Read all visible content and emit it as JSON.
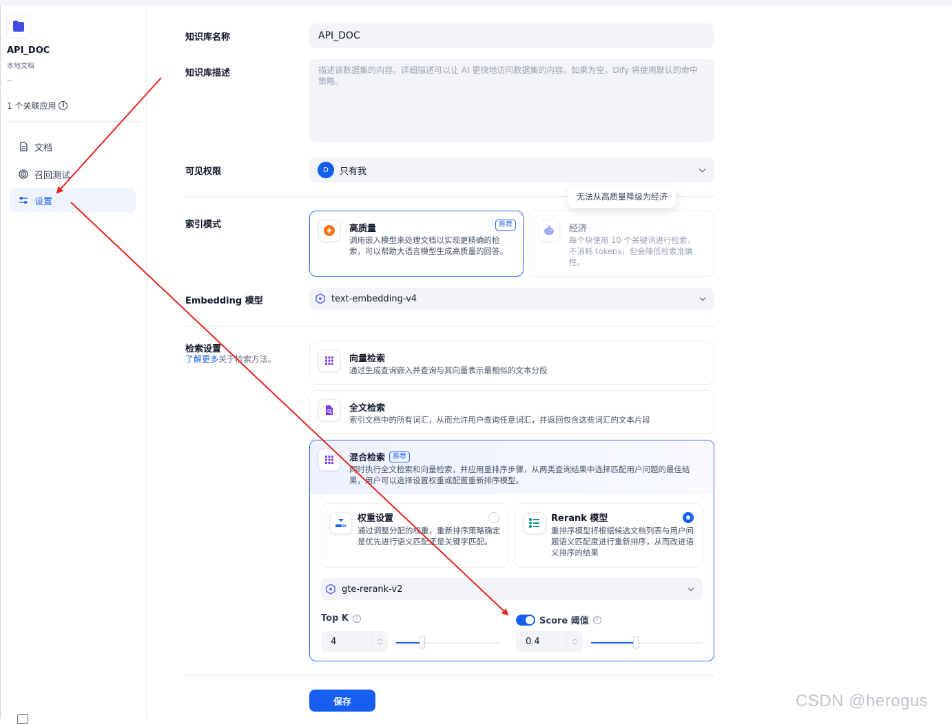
{
  "sidebar": {
    "dataset_name": "API_DOC",
    "dataset_type": "本地文档",
    "dataset_desc": "--",
    "linked_apps": "1 个关联应用",
    "nav": [
      {
        "label": "文档",
        "icon": "document-icon"
      },
      {
        "label": "召回测试",
        "icon": "target-icon"
      },
      {
        "label": "设置",
        "icon": "sliders-icon",
        "active": true
      }
    ]
  },
  "form": {
    "name_label": "知识库名称",
    "name_value": "API_DOC",
    "desc_label": "知识库描述",
    "desc_placeholder": "描述该数据集的内容。详细描述可以让 AI 更快地访问数据集的内容。如果为空，Dify 将使用默认的命中策略。",
    "perm_label": "可见权限",
    "perm_avatar": "D",
    "perm_value": "只有我",
    "index_label": "索引模式",
    "tooltip": "无法从高质量降级为经济",
    "index_hq": {
      "title": "高质量",
      "badge": "推荐",
      "desc": "调用嵌入模型来处理文档以实现更精确的检索，可以帮助大语言模型生成高质量的回答。"
    },
    "index_eco": {
      "title": "经济",
      "desc": "每个块使用 10 个关键词进行检索，不消耗 tokens，但会降低检索准确性。"
    },
    "embedding_label": "Embedding 模型",
    "embedding_value": "text-embedding-v4",
    "retrieval_label": "检索设置",
    "learn_more": "了解更多",
    "learn_more_suffix": "关于检索方法。",
    "vector": {
      "title": "向量检索",
      "desc": "通过生成查询嵌入并查询与其向量表示最相似的文本分段"
    },
    "fulltext": {
      "title": "全文检索",
      "desc": "索引文档中的所有词汇，从而允许用户查询任意词汇，并返回包含这些词汇的文本片段"
    },
    "hybrid": {
      "title": "混合检索",
      "badge": "推荐",
      "desc": "同时执行全文检索和向量检索，并应用重排序步骤，从两类查询结果中选择匹配用户问题的最佳结果，用户可以选择设置权重或配置重新排序模型。",
      "weight": {
        "title": "权重设置",
        "desc": "通过调整分配的权重，重新排序策略确定是优先进行语义匹配还是关键字匹配。",
        "selected": false
      },
      "rerank": {
        "title": "Rerank 模型",
        "desc": "重排序模型将根据候选文档列表与用户问题语义匹配度进行重新排序，从而改进语义排序的结果",
        "selected": true
      },
      "rerank_model": "gte-rerank-v2",
      "topk_label": "Top K",
      "topk_value": "4",
      "topk_fraction": 0.25,
      "score_label": "Score 阈值",
      "score_enabled": true,
      "score_value": "0.4",
      "score_fraction": 0.4
    },
    "save_label": "保存"
  },
  "watermark": "CSDN @herogus",
  "colors": {
    "accent": "#155eef",
    "arrow": "#e8231a"
  }
}
